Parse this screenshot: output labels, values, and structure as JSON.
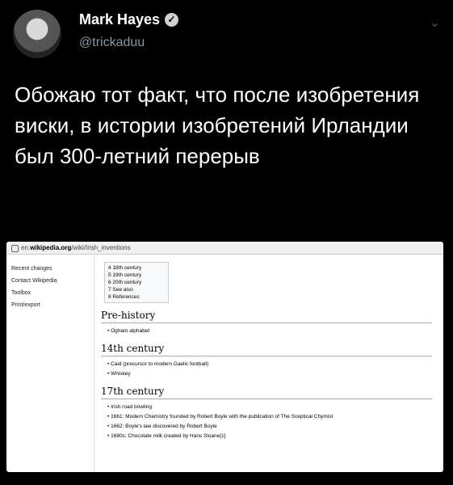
{
  "user": {
    "name": "Mark Hayes",
    "handle": "@trickaduu"
  },
  "tweet": {
    "text": "Обожаю тот факт, что после изобретения виски, в истории изобретений Ирландии был 300-летний перерыв"
  },
  "screenshot": {
    "url_prefix": "en.",
    "url_domain": "wikipedia.org",
    "url_path": "/wiki/Irish_inventions",
    "sidebar": [
      "Recent changes",
      "Contact Wikipedia",
      "Toolbox",
      "Print/export"
    ],
    "toc": [
      "4 18th century",
      "5 19th century",
      "6 20th century",
      "7 See also",
      "8 References"
    ],
    "sections": [
      {
        "title": "Pre-history",
        "items": [
          "Ogham alphabet"
        ]
      },
      {
        "title": "14th century",
        "items": [
          "Caid (precursor to modern Gaelic football)",
          "Whiskey"
        ]
      },
      {
        "title": "17th century",
        "items": [
          "Irish road bowling",
          "1661: Modern Chemistry founded by Robert Boyle with the publication of The Sceptical Chymist",
          "1662: Boyle's law discovered by Robert Boyle",
          "1680s: Chocolate milk created by Hans Sloane[1]"
        ]
      }
    ]
  }
}
